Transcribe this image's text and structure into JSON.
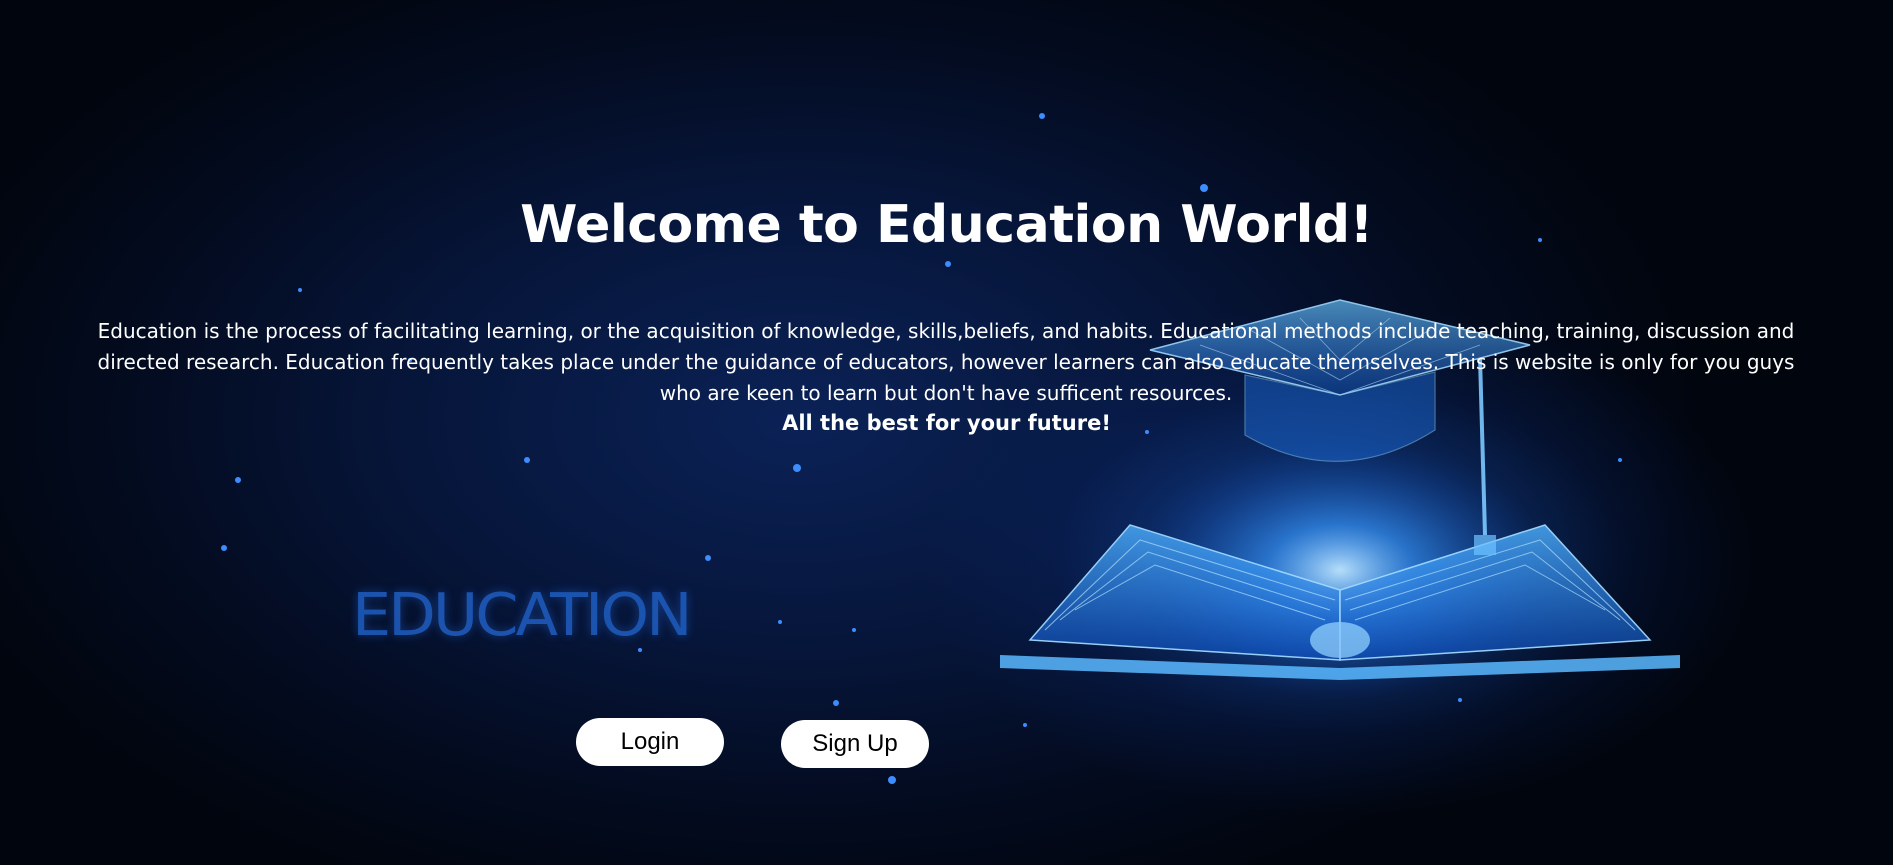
{
  "page": {
    "title": "Welcome to Education World!",
    "intro": "Education is the process of facilitating learning, or the acquisition of knowledge, skills,beliefs, and habits. Educational methods include teaching, training, discussion and directed research. Education frequently takes place under the guidance of educators, however learners can also educate themselves. This is website is only for you guys who are keen to learn but don't have sufficent resources.",
    "tagline": "All the best for your future!"
  },
  "background": {
    "wordmark": "EDUCATION",
    "illustration": "graduation-cap-and-open-book-illustration",
    "accent_color": "#1f6fe0"
  },
  "actions": {
    "login_label": "Login",
    "signup_label": "Sign Up"
  }
}
